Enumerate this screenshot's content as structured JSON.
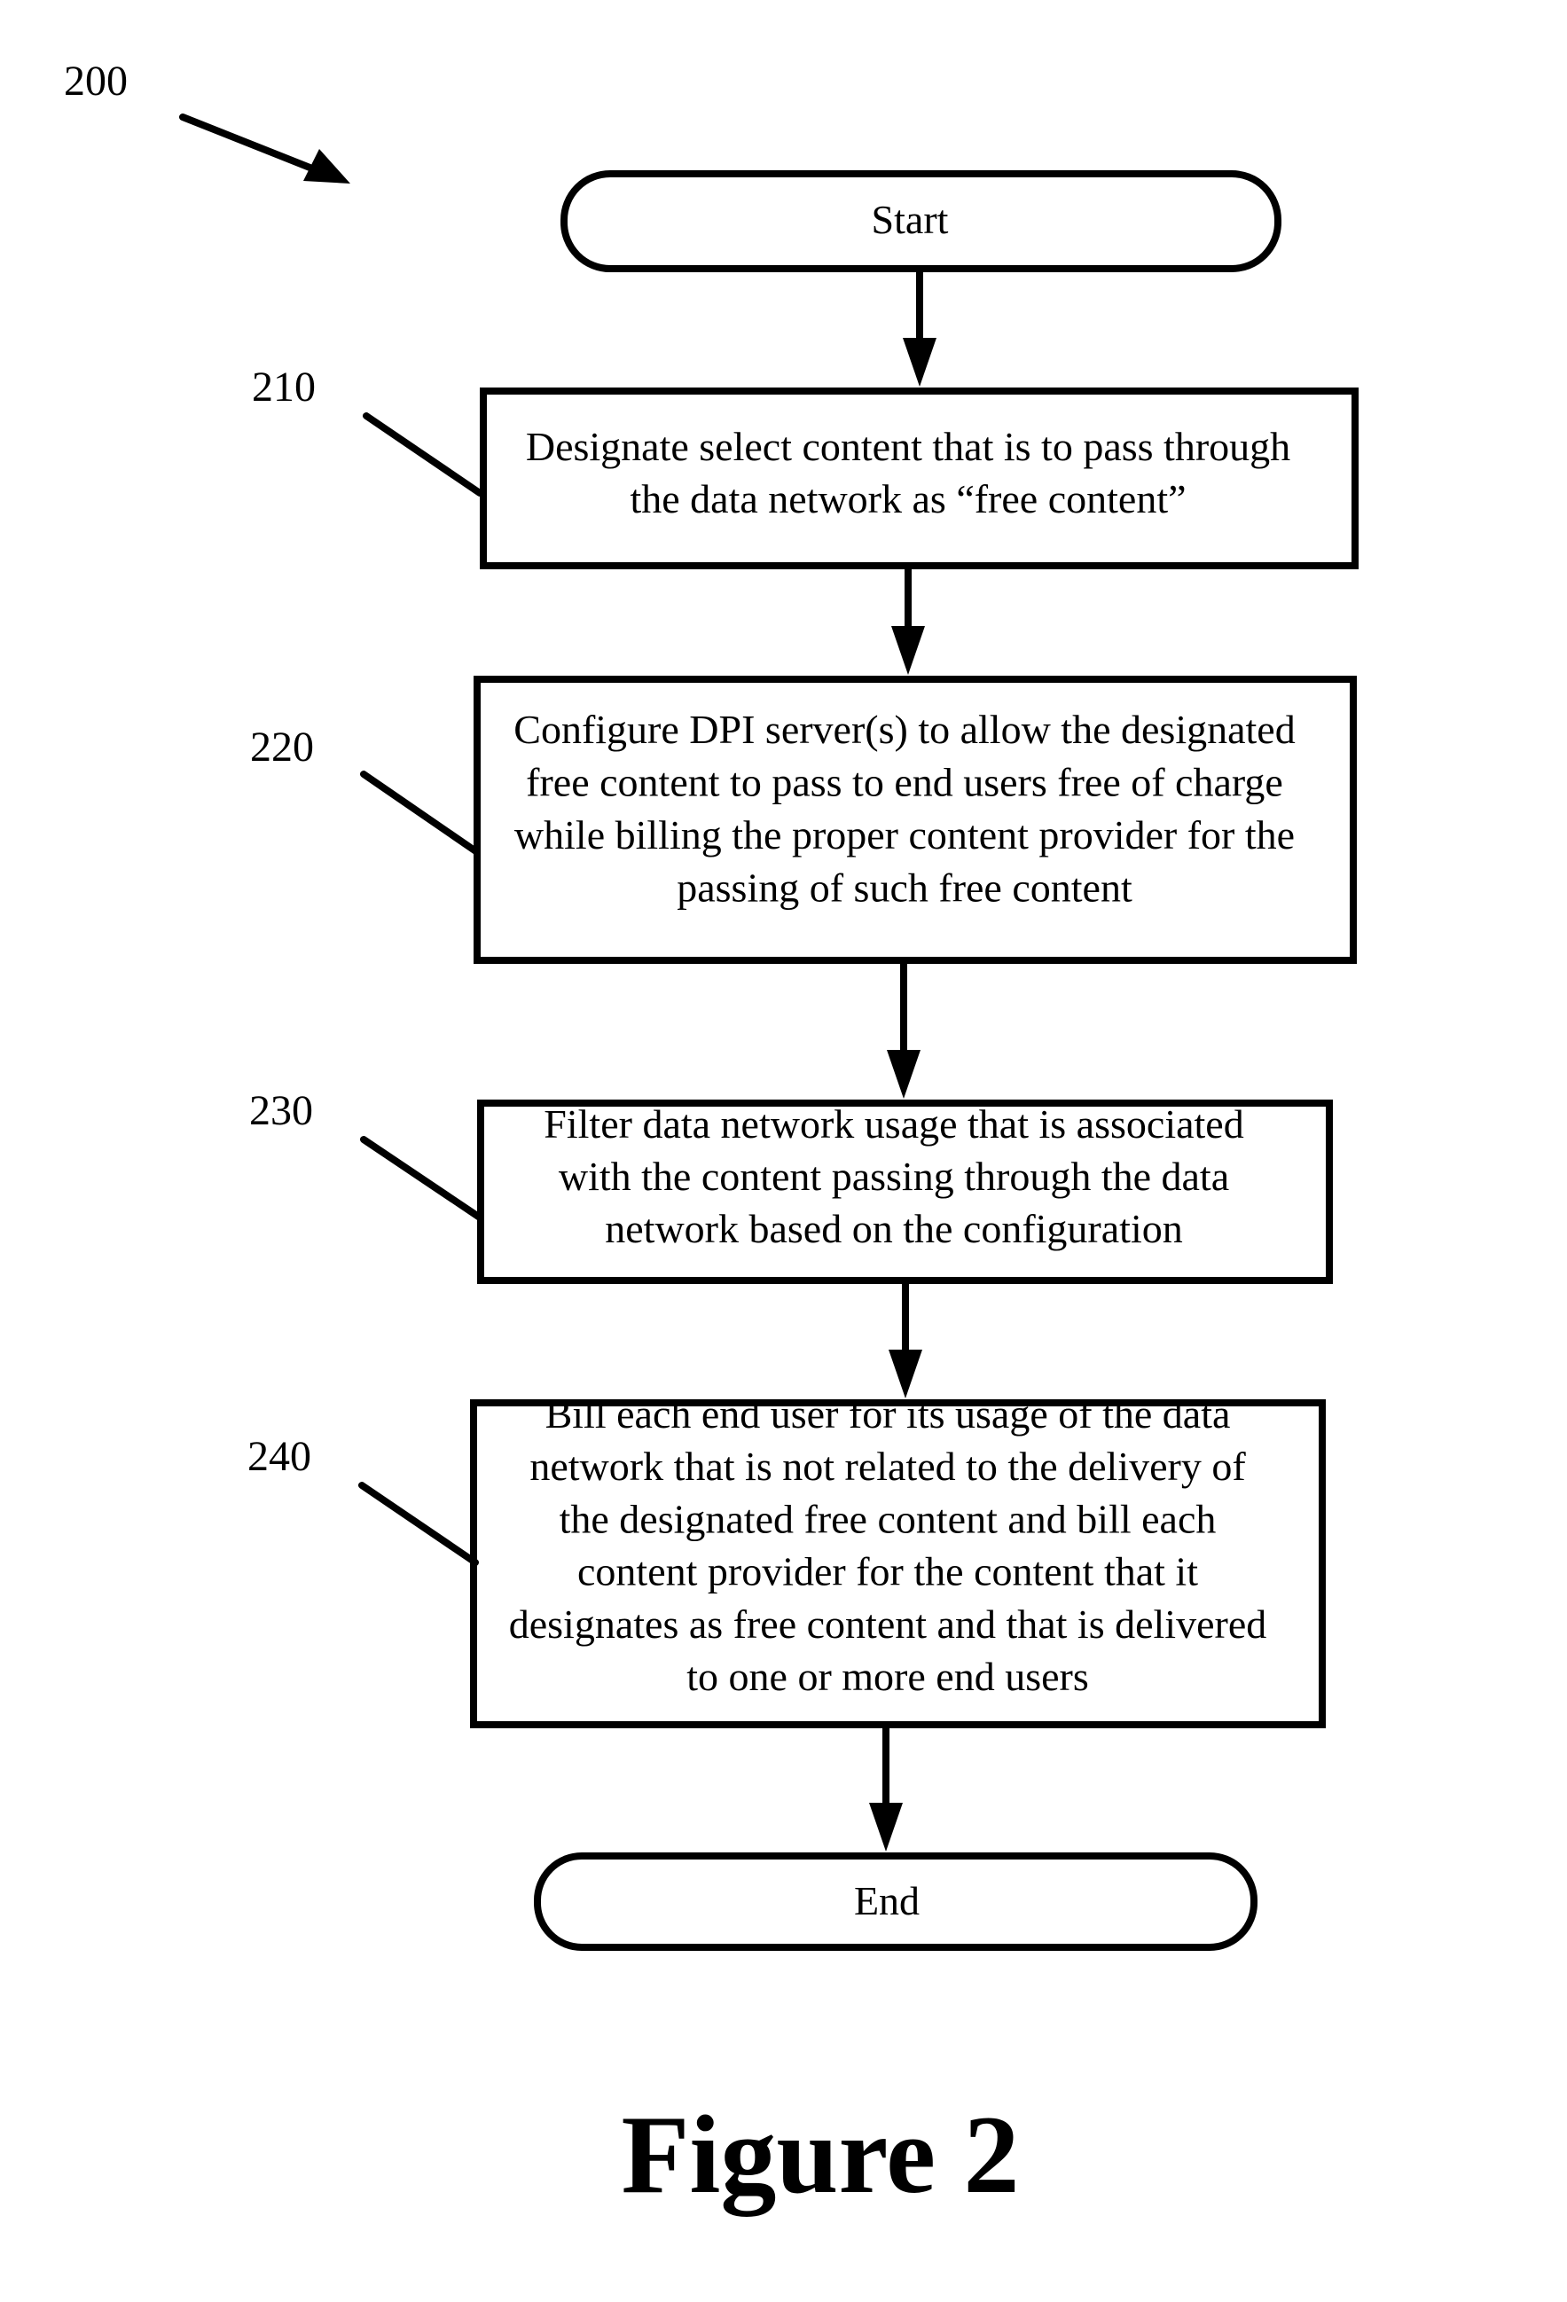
{
  "figure": {
    "reference_number": "200",
    "caption": "Figure 2",
    "ink_color": "#000000",
    "background_color": "#ffffff"
  },
  "flowchart": {
    "start": {
      "label": "Start"
    },
    "steps": [
      {
        "ref": "210",
        "lines": [
          "Designate select content that is to pass through",
          "the data network as “free content”"
        ]
      },
      {
        "ref": "220",
        "lines": [
          "Configure DPI server(s) to allow the designated",
          "free content to pass to end users free of charge",
          "while billing the proper content provider for the",
          "passing of such free content"
        ]
      },
      {
        "ref": "230",
        "lines": [
          "Filter data network usage that is associated",
          "with the content passing through the data",
          "network based on the configuration"
        ]
      },
      {
        "ref": "240",
        "lines": [
          "Bill each end user for its usage of the data",
          "network that is not related to the delivery of",
          "the designated free content and bill each",
          "content provider for the content that it",
          "designates as free content and that is delivered",
          "to one or more end users"
        ]
      }
    ],
    "end": {
      "label": "End"
    },
    "edges": [
      {
        "from": "start",
        "to": "210"
      },
      {
        "from": "210",
        "to": "220"
      },
      {
        "from": "220",
        "to": "230"
      },
      {
        "from": "230",
        "to": "240"
      },
      {
        "from": "240",
        "to": "end"
      }
    ]
  }
}
